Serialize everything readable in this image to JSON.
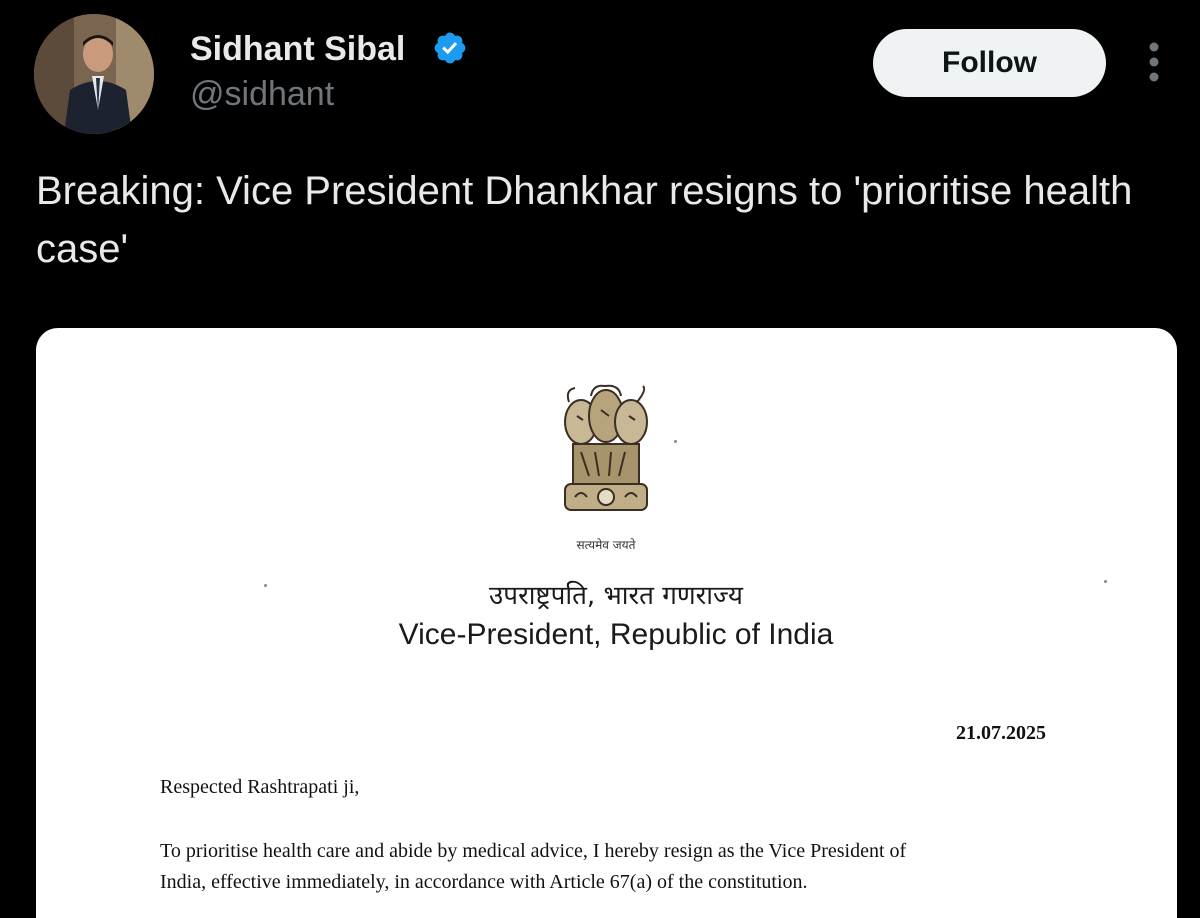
{
  "author": {
    "display_name": "Sidhant Sibal",
    "handle": "@sidhant",
    "verified_icon": "verified-badge-icon",
    "verified_color": "#1d9bf0"
  },
  "actions": {
    "follow_label": "Follow",
    "more_icon": "more-vertical-icon"
  },
  "tweet": {
    "text": "Breaking: Vice President Dhankhar resigns to 'prioritise health case'"
  },
  "media": {
    "letter": {
      "emblem_icon": "national-emblem-icon",
      "emblem_caption": "सत्यमेव जयते",
      "hindi_heading": "उपराष्ट्रपति, भारत गणराज्य",
      "english_heading": "Vice-President, Republic of India",
      "date": "21.07.2025",
      "salutation": "Respected Rashtrapati ji,",
      "body_line_1": "To prioritise health care and abide by medical advice, I hereby resign as the Vice President of",
      "body_line_2": "India, effective immediately, in accordance with Article 67(a) of the constitution."
    }
  },
  "colors": {
    "background": "#000000",
    "primary_text": "#e7e9ea",
    "secondary_text": "#71767b",
    "follow_button_bg": "#eff3f4"
  }
}
